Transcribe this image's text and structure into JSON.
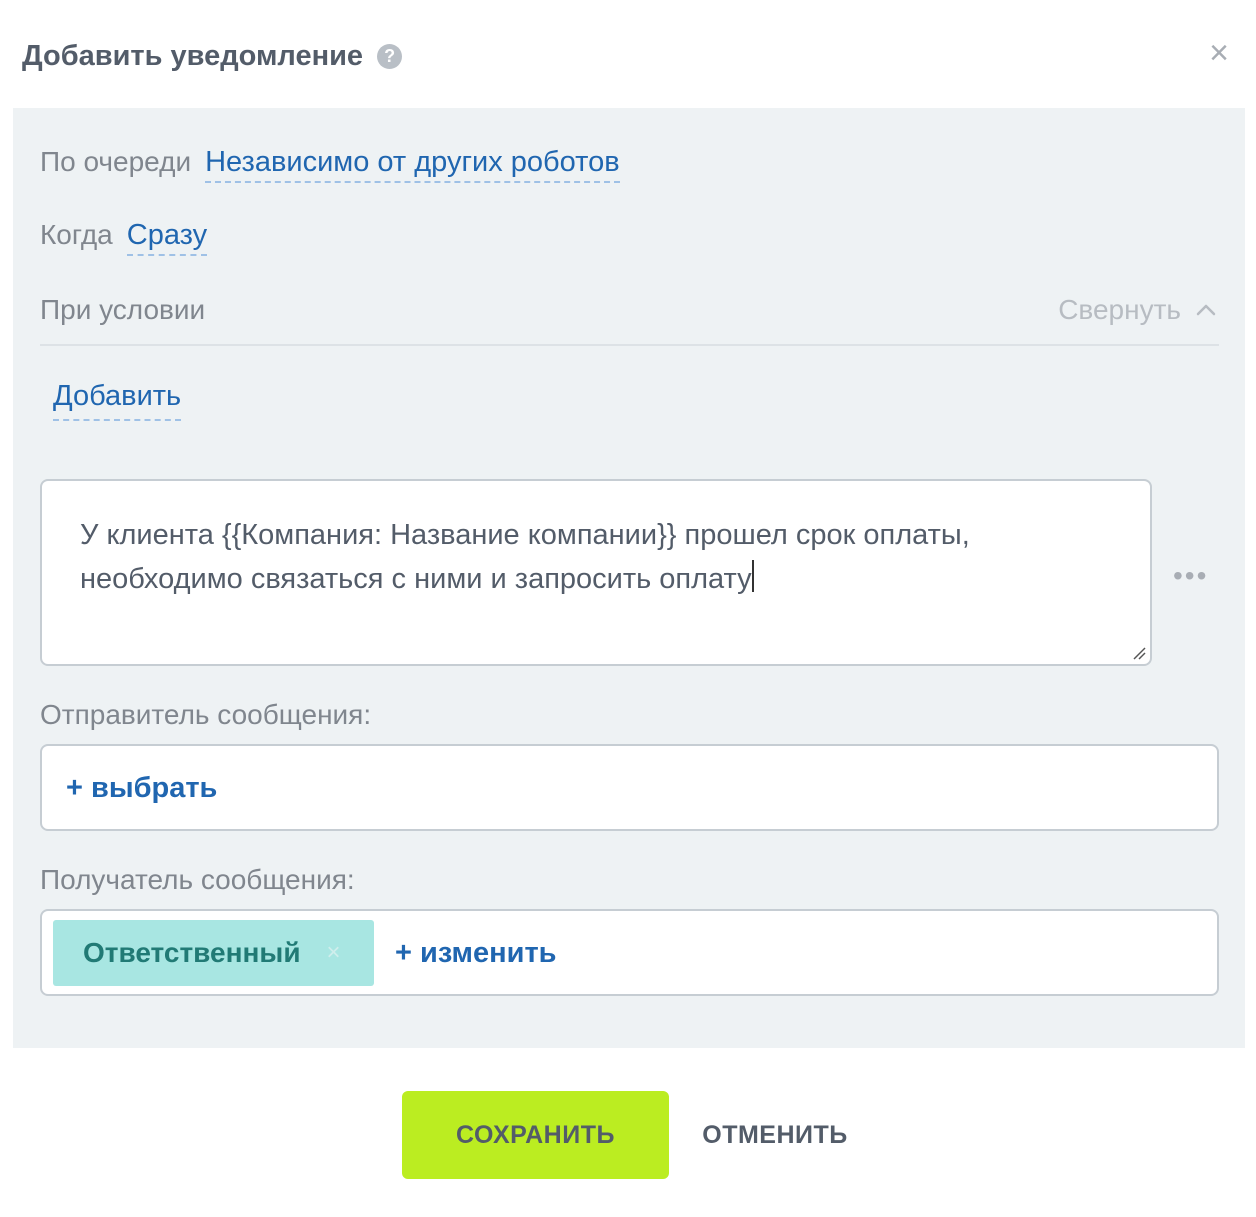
{
  "dialog": {
    "title": "Добавить уведомление",
    "help_icon_glyph": "?",
    "close_icon_glyph": "×"
  },
  "settings": {
    "queue_label": "По очереди",
    "queue_value": "Независимо от других роботов",
    "when_label": "Когда",
    "when_value": "Сразу",
    "condition_label": "При условии",
    "collapse_label": "Свернуть",
    "add_label": "Добавить"
  },
  "message": {
    "text": "У клиента {{Компания: Название компании}} прошел срок оплаты, необходимо связаться с ними и запросить оплату",
    "more_icon_glyph": "•••"
  },
  "sender": {
    "label": "Отправитель сообщения:",
    "pick_label": "+ выбрать"
  },
  "recipient": {
    "label": "Получатель сообщения:",
    "tag_label": "Ответственный",
    "tag_close_glyph": "×",
    "change_label": "+ изменить"
  },
  "footer": {
    "save_label": "СОХРАНИТЬ",
    "cancel_label": "ОТМЕНИТЬ"
  },
  "colors": {
    "link": "#2066b0",
    "save_button": "#bbed21",
    "tag_background": "#a8e6e2",
    "panel_background": "#eef2f4"
  },
  "icons": [
    "help-icon",
    "close-icon",
    "chevron-up-icon",
    "more-icon",
    "resize-icon",
    "tag-close-icon"
  ]
}
